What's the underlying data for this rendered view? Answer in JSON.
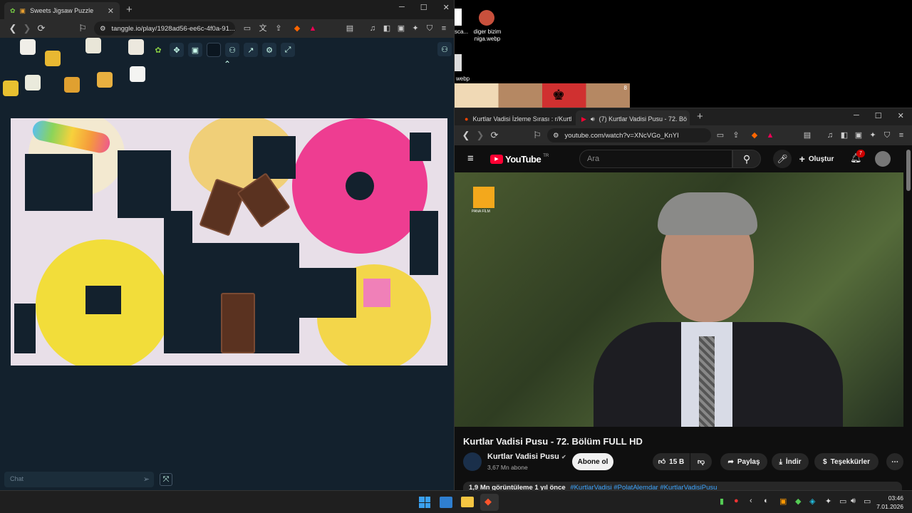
{
  "left_browser": {
    "tab_title": "Sweets Jigsaw Puzzle",
    "url": "tanggle.io/play/1928ad56-ee6c-4f0a-91...",
    "chat_placeholder": "Chat"
  },
  "desktop": {
    "icon1_label": "sca...",
    "icon2_label": "diger bizim\nniga.webp",
    "icon3_label": "webp",
    "chess_badge": "8"
  },
  "right_browser": {
    "tab1_title": "Kurtlar Vadisi İzleme Sırası : r/Kurtlar",
    "tab2_title": "(7) Kurtlar Vadisi Pusu - 72. Bö",
    "url": "youtube.com/watch?v=XNcVGo_KnYI",
    "yt_logo": "YouTube",
    "yt_region": "TR",
    "search_placeholder": "Ara",
    "create_label": "Oluştur",
    "notif_count": "7",
    "video_logo_text": "PANA FİLM",
    "video_title": "Kurtlar Vadisi Pusu - 72. Bölüm FULL HD",
    "channel_name": "Kurtlar Vadisi Pusu",
    "subscribers": "3,67 Mn abone",
    "subscribe_label": "Abone ol",
    "likes": "15 B",
    "share_label": "Paylaş",
    "download_label": "İndir",
    "thanks_label": "Teşekkürler",
    "views_line": "1,9 Mn görüntüleme  1 yıl önce",
    "hashtags": "#KurtlarVadisi #PolatAlemdar #KurtlarVadisiPusu"
  },
  "taskbar": {
    "time": "03:46",
    "date": "7.01.2026"
  },
  "colors": {
    "accent_red": "#ff0033",
    "puzzle_bg": "#13212d"
  }
}
